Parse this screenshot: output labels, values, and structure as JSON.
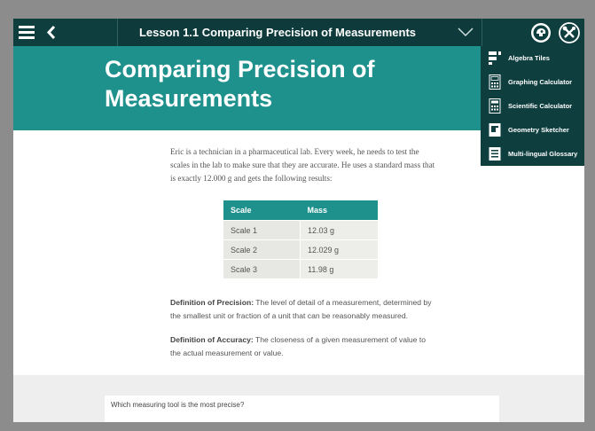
{
  "header": {
    "title": "Lesson 1.1 Comparing Precision of Measurements"
  },
  "hero": {
    "heading": "Comparing Precision of Measurements"
  },
  "intro": "Eric is a technician in a pharmaceutical lab. Every week, he needs to test the scales in the lab to make sure that they are accurate. He uses a standard mass that is exactly 12.000 g and gets the following results:",
  "table": {
    "headers": [
      "Scale",
      "Mass"
    ],
    "rows": [
      [
        "Scale 1",
        "12.03 g"
      ],
      [
        "Scale 2",
        "12.029 g"
      ],
      [
        "Scale 3",
        "11.98 g"
      ]
    ]
  },
  "definitions": {
    "precision_label": "Definition of Precision:",
    "precision_text": " The level of detail of a measurement, determined by the smallest unit or fraction of a unit that can be reasonably measured.",
    "accuracy_label": "Definition of Accuracy:",
    "accuracy_text": " The closeness of a given measurement of value to the actual measurement or value."
  },
  "question": "Which measuring tool is the most precise?",
  "tools": [
    {
      "label": "Algebra Tiles",
      "icon": "algebra-tiles-icon"
    },
    {
      "label": "Graphing Calculator",
      "icon": "graphing-calculator-icon"
    },
    {
      "label": "Scientific Calculator",
      "icon": "scientific-calculator-icon"
    },
    {
      "label": "Geometry Sketcher",
      "icon": "geometry-sketcher-icon"
    },
    {
      "label": "Multi-lingual Glossary",
      "icon": "glossary-icon"
    }
  ],
  "colors": {
    "teal": "#1f918d",
    "dark_teal": "#0f3e3f"
  }
}
